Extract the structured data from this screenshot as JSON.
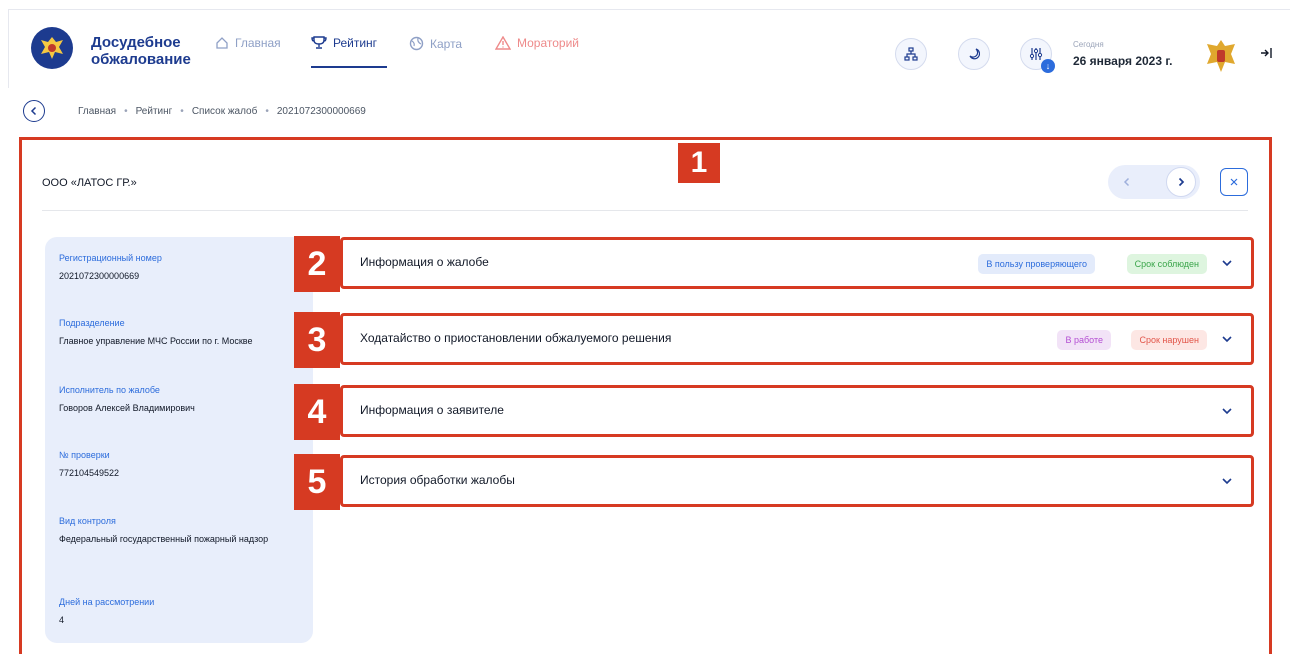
{
  "header": {
    "app_title": "Досудебное обжалование",
    "nav": [
      {
        "label": "Главная",
        "icon": "home-icon"
      },
      {
        "label": "Рейтинг",
        "icon": "trophy-icon"
      },
      {
        "label": "Карта",
        "icon": "globe-icon"
      },
      {
        "label": "Мораторий",
        "icon": "warning-icon"
      }
    ],
    "date_label": "Сегодня",
    "date_value": "26 января 2023 г."
  },
  "breadcrumb": [
    "Главная",
    "Рейтинг",
    "Список жалоб",
    "2021072300000669"
  ],
  "panel": {
    "title": "ООО «ЛАТОС ГР.»",
    "annotation": "1"
  },
  "sidebar": [
    {
      "label": "Регистрационный номер",
      "value": "2021072300000669"
    },
    {
      "label": "Подразделение",
      "value": "Главное управление МЧС России по г. Москве"
    },
    {
      "label": "Исполнитель по жалобе",
      "value": "Говоров Алексей Владимирович"
    },
    {
      "label": "№ проверки",
      "value": "772104549522"
    },
    {
      "label": "Вид контроля",
      "value": "Федеральный государственный пожарный надзор"
    },
    {
      "label": "Дней на рассмотрении",
      "value": "4"
    }
  ],
  "sections": [
    {
      "num": "2",
      "title": "Информация о жалобе",
      "badges": [
        "В пользу проверяющего",
        "Срок соблюден"
      ]
    },
    {
      "num": "3",
      "title": "Ходатайство о приостановлении обжалуемого решения",
      "badges": [
        "В работе",
        "Срок нарушен"
      ]
    },
    {
      "num": "4",
      "title": "Информация о заявителе",
      "badges": []
    },
    {
      "num": "5",
      "title": "История обработки жалобы",
      "badges": []
    }
  ],
  "colors": {
    "accent": "#1d3b8f",
    "highlight": "#d63a22"
  }
}
